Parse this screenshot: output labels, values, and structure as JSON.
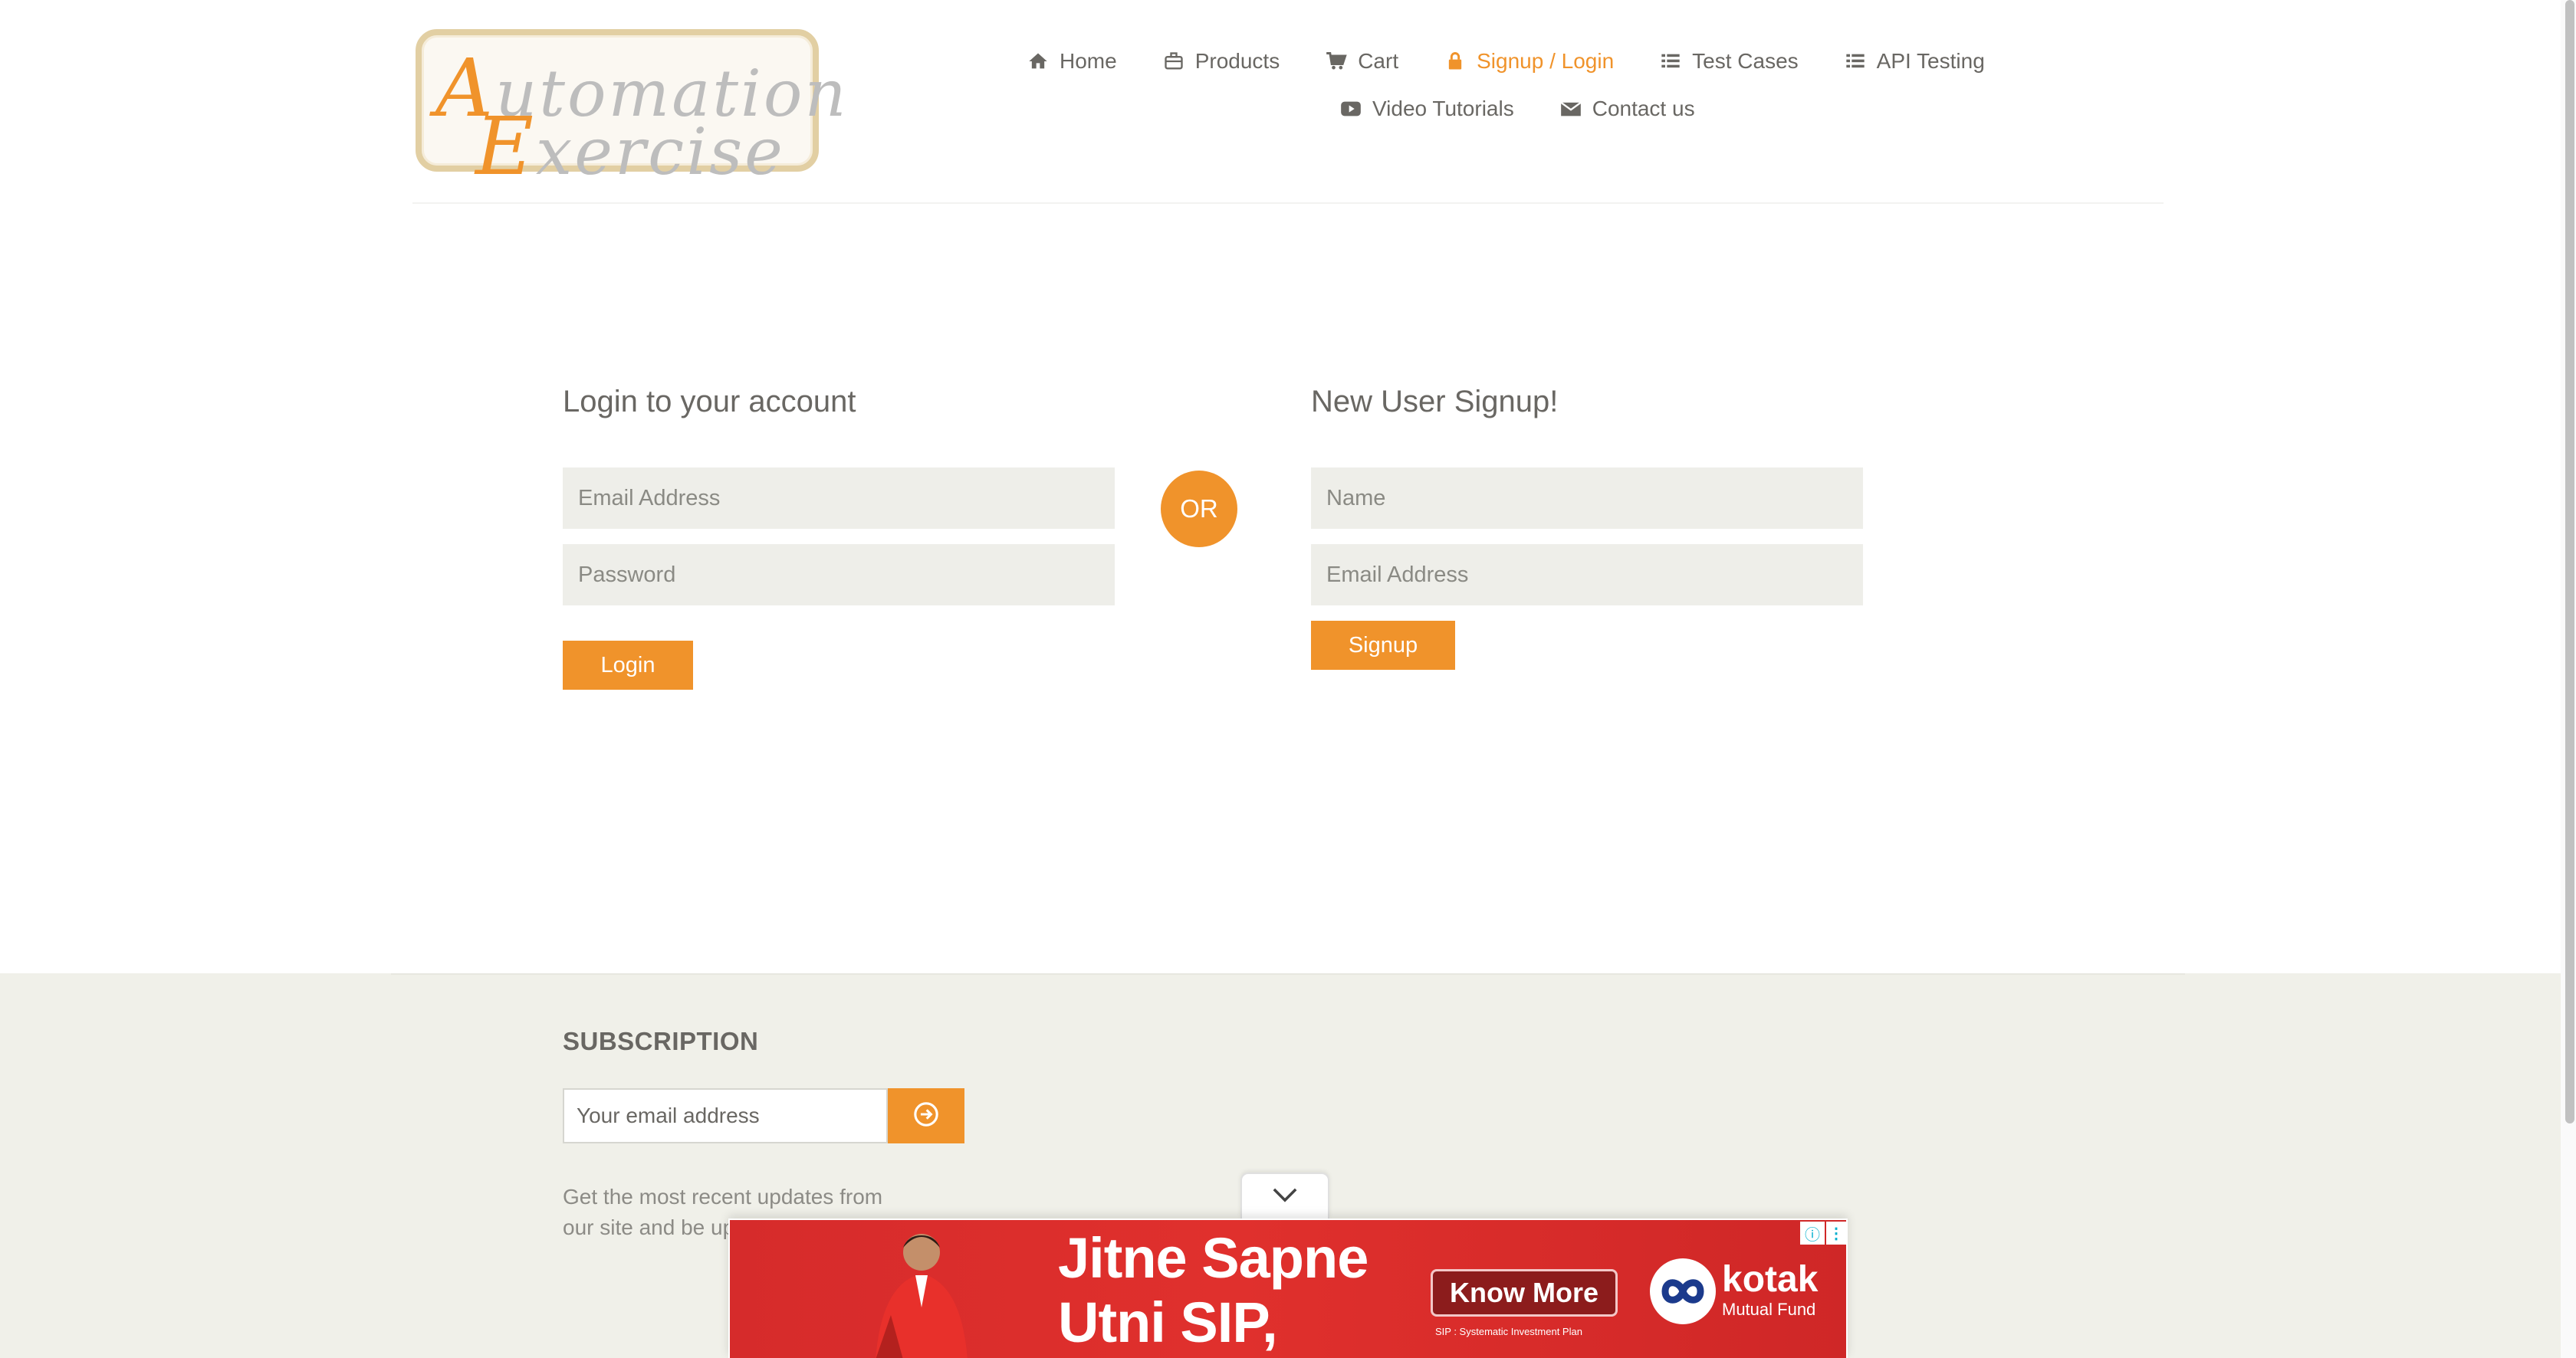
{
  "logo": {
    "line1_cap": "A",
    "line1_rest": "utomation",
    "line2_cap": "E",
    "line2_rest": "xercise"
  },
  "nav": {
    "items": [
      {
        "label": "Home",
        "icon": "home-icon"
      },
      {
        "label": "Products",
        "icon": "briefcase-icon"
      },
      {
        "label": "Cart",
        "icon": "cart-icon"
      },
      {
        "label": "Signup / Login",
        "icon": "lock-icon",
        "active": true
      },
      {
        "label": "Test Cases",
        "icon": "list-icon"
      },
      {
        "label": "API Testing",
        "icon": "list-icon"
      },
      {
        "label": "Video Tutorials",
        "icon": "youtube-icon"
      },
      {
        "label": "Contact us",
        "icon": "envelope-icon"
      }
    ]
  },
  "login": {
    "title": "Login to your account",
    "email_placeholder": "Email Address",
    "password_placeholder": "Password",
    "button": "Login"
  },
  "or_label": "OR",
  "signup": {
    "title": "New User Signup!",
    "name_placeholder": "Name",
    "email_placeholder": "Email Address",
    "button": "Signup"
  },
  "footer": {
    "subscription_title": "SUBSCRIPTION",
    "email_placeholder": "Your email address",
    "description": "Get the most recent updates from our site and be up"
  },
  "ad": {
    "headline_line1": "Jitne Sapne",
    "headline_line2": "Utni SIP,",
    "cta": "Know More",
    "fine_print": "SIP : Systematic Investment Plan",
    "brand": "kotak",
    "brand_sub": "Mutual Fund",
    "info_glyph": "ⓘ",
    "more_glyph": "⋮"
  },
  "colors": {
    "accent": "#f0932b",
    "text": "#696763",
    "field_bg": "#eeeee9",
    "footer_bg": "#f0f0e9",
    "ad_red": "#d62b2b"
  }
}
